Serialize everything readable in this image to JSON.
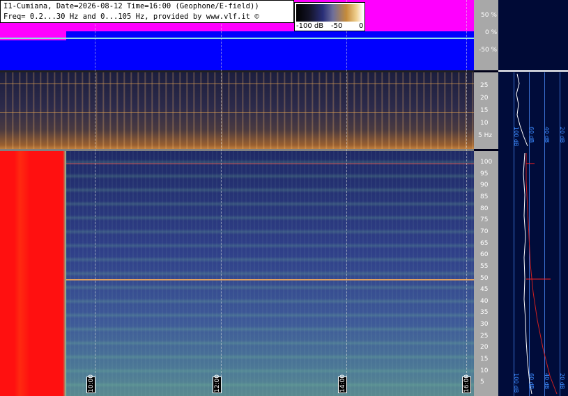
{
  "header": {
    "line1": "I1-Cumiana, Date=2026-08-12 Time=16:00 (Geophone/E-field))",
    "line2": "Freq= 0.2...30 Hz and 0...105 Hz, provided by www.vlf.it ©"
  },
  "legend": {
    "min": "-100 dB",
    "mid": "-50",
    "max": "0"
  },
  "amplitude_scale": [
    "50 %",
    "0 %",
    "-50 %"
  ],
  "low_freq_scale": [
    "25",
    "20",
    "15",
    "10",
    "5 Hz"
  ],
  "high_freq_scale": [
    "100",
    "95",
    "90",
    "85",
    "80",
    "75",
    "70",
    "65",
    "60",
    "55",
    "50",
    "45",
    "40",
    "35",
    "30",
    "25",
    "20",
    "15",
    "10",
    "5"
  ],
  "time_labels": [
    "10:00",
    "12:00",
    "14:00",
    "16:00"
  ],
  "right_panel_labels": [
    "100 dB",
    "60 dB",
    "40 dB",
    "20 dB"
  ],
  "colors": {
    "magenta": "#ff00ff",
    "blue": "#0000ff",
    "red": "#ff1010",
    "scale_gray": "#a8a8a8"
  }
}
